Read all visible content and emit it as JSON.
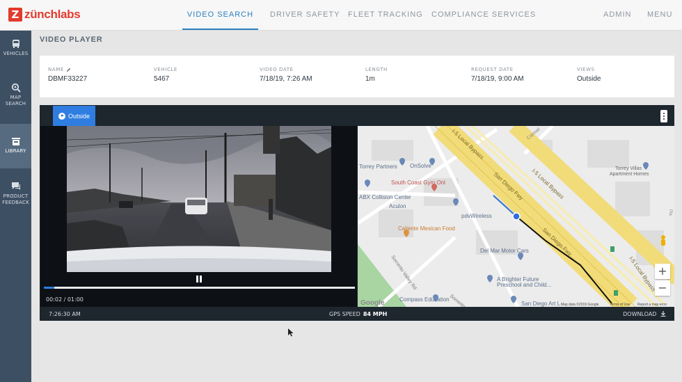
{
  "brand": {
    "name": "zünchlabs",
    "mark": "Z",
    "color": "#e23b2e"
  },
  "nav": {
    "items": [
      "VIDEO SEARCH",
      "DRIVER SAFETY",
      "FLEET TRACKING",
      "COMPLIANCE SERVICES"
    ],
    "active": "VIDEO SEARCH",
    "right": [
      "ADMIN",
      "MENU"
    ],
    "accent": "#2a7fc1"
  },
  "sidebar": {
    "items": [
      {
        "label1": "VEHICLES",
        "label2": "",
        "icon": "bus-icon"
      },
      {
        "label1": "MAP",
        "label2": "SEARCH",
        "icon": "map-search-icon"
      },
      {
        "label1": "LIBRARY",
        "label2": "",
        "icon": "library-icon"
      },
      {
        "label1": "PRODUCT",
        "label2": "FEEDBACK",
        "icon": "chat-icon"
      }
    ],
    "active": "LIBRARY"
  },
  "page": {
    "title": "VIDEO PLAYER"
  },
  "info": {
    "name_label": "NAME",
    "name": "DBMF33227",
    "vehicle_label": "VEHICLE",
    "vehicle": "5467",
    "video_date_label": "VIDEO DATE",
    "video_date": "7/18/19, 7:26 AM",
    "length_label": "LENGTH",
    "length": "1m",
    "request_date_label": "REQUEST DATE",
    "request_date": "7/18/19, 9:00 AM",
    "views_label": "VIEWS",
    "views": "Outside"
  },
  "player": {
    "tab": "Outside",
    "time": "00:02 / 01:00",
    "progress": 0.033,
    "footer_time": "7:26:30 AM",
    "gps_label": "GPS SPEED",
    "gps_value": "84 MPH",
    "download": "DOWNLOAD"
  },
  "map": {
    "labels": {
      "local_bypass_top": "I-5 Local Bypass",
      "local_bypass_right": "I-5 Local Bypass",
      "san_diego_fwy": "San Diego Fwy",
      "san_diego_fwy_2": "San Diego Fwy",
      "carmel": "Carmel",
      "torrey_villas": "Torrey Villas",
      "apartment_homes": "Apartment Homes",
      "torrey_partners": "Torrey Partners",
      "onsolve": "OnSolve",
      "south_coast_gym": "South Coast Gym Onl",
      "abx": "ABX Collision Center",
      "aculon": "Aculon",
      "pdv": "pdvWireless",
      "caliente": "Caliente Mexican Food",
      "del_mar": "Del Mar Motor Cars",
      "brighter1": "A Brighter Future",
      "brighter2": "Preschool and Child...",
      "sorrento_valley_rd": "Sorrento Valley Rd",
      "sorrento_valley": "Sorrento Valle",
      "compass": "Compass Education",
      "san_diego_art": "San Diego Art L",
      "google": "Google",
      "map_data": "Map data ©2019 Google",
      "terms": "Terms of Use",
      "report": "Report a map error",
      "zoom_in": "+",
      "zoom_out": "−",
      "edge": "Pla"
    }
  }
}
